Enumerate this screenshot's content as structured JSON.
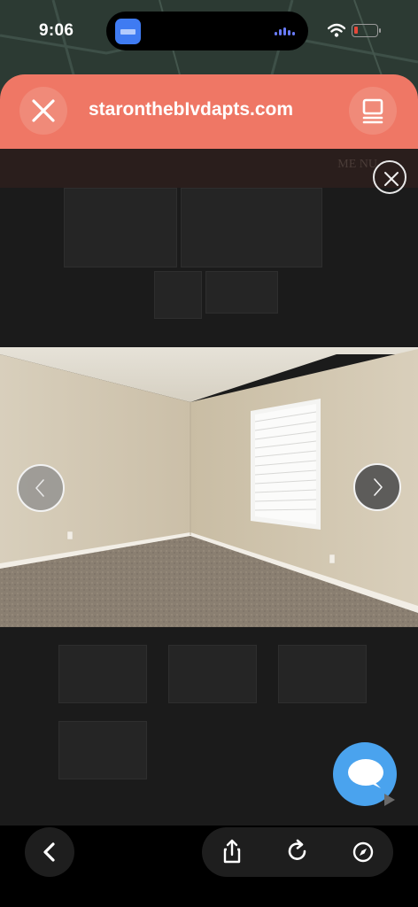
{
  "status_bar": {
    "time": "9:06"
  },
  "browser": {
    "url": "staronthebIvdapts.com",
    "accent_color": "#ef7765"
  },
  "page": {
    "header_partial_text": "ME NU",
    "photo_description_icons": {
      "prev": "chevron-left-icon",
      "next": "chevron-right-icon",
      "close": "close-icon"
    }
  },
  "toolbar": {
    "icons": [
      "back-icon",
      "share-icon",
      "reload-icon",
      "compass-icon"
    ]
  },
  "chat": {
    "icon": "chat-bubble-icon",
    "color": "#4aa3ee"
  }
}
